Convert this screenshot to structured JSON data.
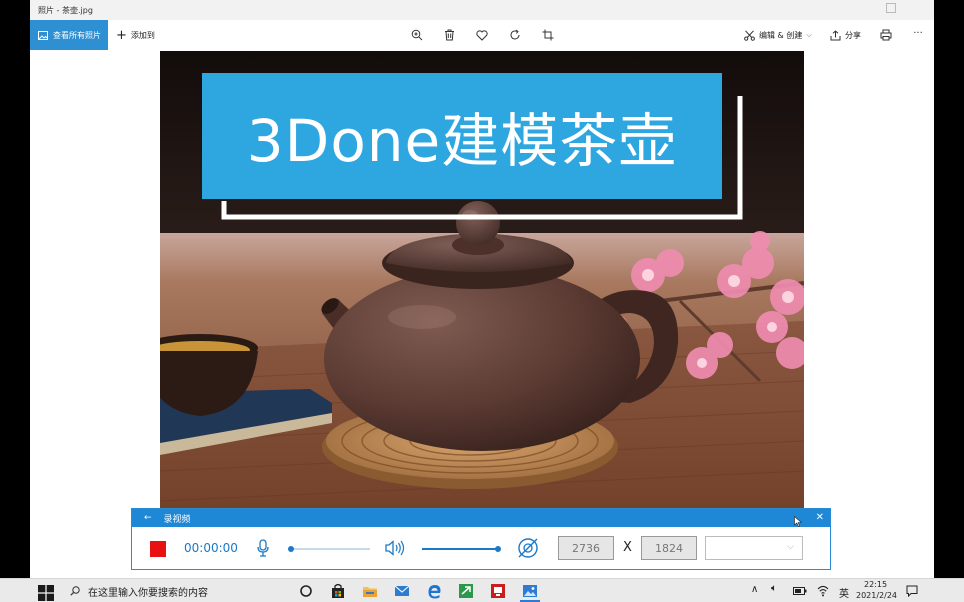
{
  "window": {
    "title": "照片 - 茶壶.jpg"
  },
  "toolbar": {
    "view_all_label": "查看所有照片",
    "add_label": "添加到",
    "edit_create_label": "编辑 & 创建",
    "share_label": "分享",
    "more_label": "···"
  },
  "photo": {
    "banner_text": "3Done建模茶壶"
  },
  "recorder": {
    "title": "录视频",
    "timer": "00:00:00",
    "width": "2736",
    "times": "X",
    "height": "1824",
    "close_label": "✕",
    "back_label": "←"
  },
  "taskbar": {
    "search_placeholder": "在这里输入你要搜索的内容",
    "ime_label": "英",
    "time": "22:15",
    "date": "2021/2/24"
  },
  "colors": {
    "accent": "#2e8fd3",
    "banner": "#2ea6e0",
    "record": "#e81010",
    "recorder_bar": "#1e88d6"
  }
}
